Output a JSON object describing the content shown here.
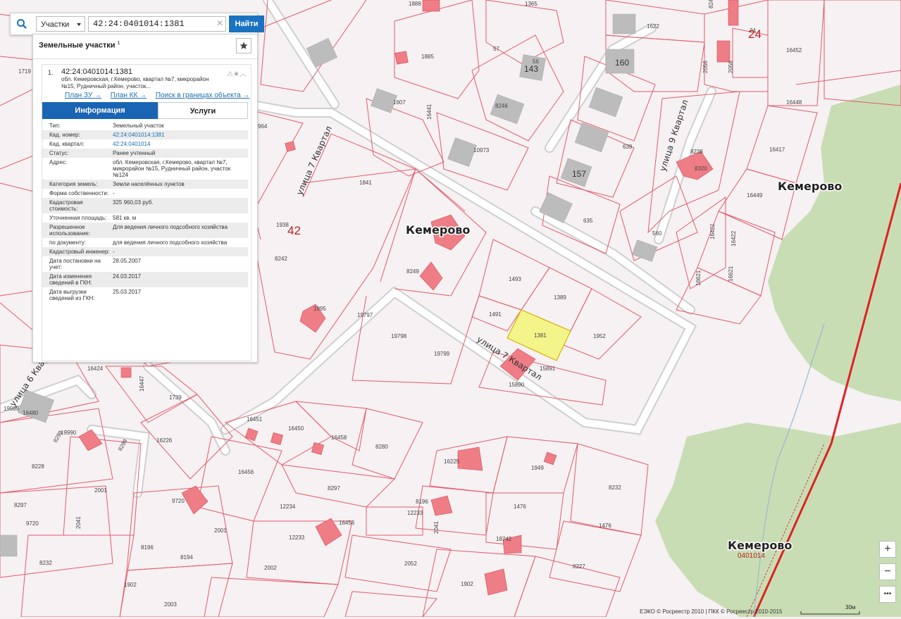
{
  "search": {
    "type_label": "Участки",
    "query": "42:24:0401014:1381",
    "button_label": "Найти",
    "icon": "search-icon"
  },
  "panel": {
    "title": "Земельные участки",
    "count": "1",
    "result": {
      "index": "1.",
      "cad_number": "42:24:0401014:1381",
      "address_short": "обл. Кемеровская, г.Кемерово, квартал №7, микрорайон №15, Рудничный район, участок...",
      "links": [
        "План ЗУ →",
        "План КК →",
        "Поиск в границах объекта →"
      ]
    },
    "tabs": [
      "Информация",
      "Услуги"
    ],
    "rows": [
      {
        "k": "Тип:",
        "v": "Земельный участок"
      },
      {
        "k": "Кад. номер:",
        "v": "42:24:0401014:1381"
      },
      {
        "k": "Кад. квартал:",
        "v": "42:24:0401014"
      },
      {
        "k": "Статус:",
        "v": "Ранее учтенный"
      },
      {
        "k": "Адрес:",
        "v": "обл. Кемеровская, г.Кемерово, квартал №7, микрорайон №15, Рудничный район, участок №124"
      },
      {
        "k": "Категория земель:",
        "v": "Земли населённых пунктов"
      },
      {
        "k": "Форма собственности:",
        "v": "-"
      },
      {
        "k": "Кадастровая стоимость:",
        "v": "325 960,03 руб."
      },
      {
        "k": "Уточненная площадь:",
        "v": "581 кв. м"
      },
      {
        "k": "Разрешенное использование:",
        "v": "Для ведения личного подсобного хозяйства"
      },
      {
        "k": "по документу:",
        "v": "для ведения личного подсобного хозяйства"
      },
      {
        "k": "Кадастровый инженер:",
        "v": "-"
      },
      {
        "k": "Дата постановки на учет:",
        "v": "28.05.2007"
      },
      {
        "k": "Дата изменения сведений в ГКН:",
        "v": "24.03.2017"
      },
      {
        "k": "Дата выгрузки сведений из ГКН:",
        "v": "25.03.2017"
      }
    ]
  },
  "map": {
    "city_labels": [
      "Кемерово",
      "Кемерово",
      "Кемерово"
    ],
    "quarter_code": "0401014",
    "quarter_numbers": [
      "42",
      "24"
    ],
    "streets": [
      "улица 7 Квартал",
      "улица 7 Квартал",
      "улица 9 Квартал",
      "улица 6 Квартал"
    ],
    "house_numbers": [
      "143",
      "160",
      "157"
    ],
    "selected_parcel": "1381",
    "parcel_labels": [
      "1365",
      "1888",
      "1622",
      "8248",
      "16452",
      "1885",
      "57",
      "56",
      "2056",
      "2056",
      "24",
      "1719",
      "1607",
      "16441",
      "8246",
      "16448",
      "964",
      "10973",
      "639",
      "8238",
      "8320",
      "16417",
      "1841",
      "1938",
      "635",
      "560",
      "16449",
      "16422",
      "16422",
      "8242",
      "1493",
      "1389",
      "16621",
      "16621",
      "8249",
      "19797",
      "1491",
      "1952",
      "1995",
      "19798",
      "19799",
      "15891",
      "15890",
      "16424",
      "16447",
      "1739",
      "19989",
      "16480",
      "16451",
      "16450",
      "16458",
      "8280",
      "19990",
      "8299",
      "8299",
      "16226",
      "16225",
      "1949",
      "8228",
      "16456",
      "8232",
      "2001",
      "8297",
      "9720",
      "12234",
      "8196",
      "1476",
      "8297",
      "2001",
      "16456",
      "1476",
      "9720",
      "12233",
      "12233",
      "2041",
      "8196",
      "18742",
      "8227",
      "8232",
      "2041",
      "8194",
      "2002",
      "2052",
      "1902",
      "1902",
      "2003"
    ],
    "attribution": "ЕЭКО © Росреестр 2010 | ПКК © Росреестр 2010-2015",
    "scale": "30м",
    "zoom_in": "+",
    "zoom_out": "−",
    "more": "•••"
  }
}
